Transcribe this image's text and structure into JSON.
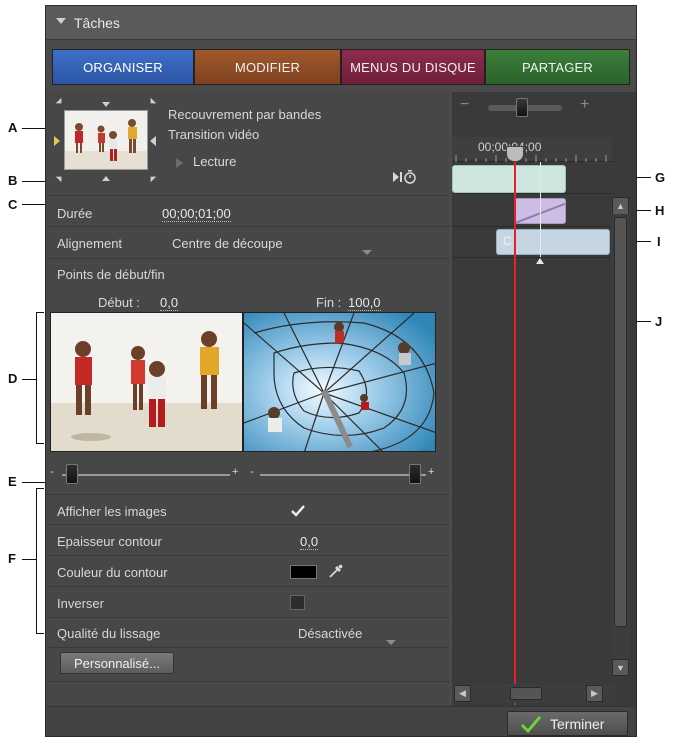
{
  "panel": {
    "title": "Tâches",
    "tabs": [
      {
        "label": "ORGANISER"
      },
      {
        "label": "MODIFIER"
      },
      {
        "label": "MENUS DU DISQUE"
      },
      {
        "label": "PARTAGER"
      }
    ]
  },
  "transition": {
    "name": "Recouvrement par bandes",
    "type": "Transition vidéo",
    "play_label": "Lecture"
  },
  "properties": {
    "duration_label": "Durée",
    "duration_value": "00;00;01;00",
    "alignment_label": "Alignement",
    "alignment_value": "Centre de découpe",
    "inout_label": "Points de début/fin",
    "start_label": "Début :",
    "start_value": "0,0",
    "end_label": "Fin :",
    "end_value": "100,0",
    "show_images_label": "Afficher les images",
    "show_images_checked": true,
    "border_width_label": "Epaisseur contour",
    "border_width_value": "0,0",
    "border_color_label": "Couleur du contour",
    "border_color": "#000000",
    "invert_label": "Inverser",
    "invert_checked": false,
    "smoothing_label": "Qualité du lissage",
    "smoothing_value": "Désactivée",
    "custom_button": "Personnalisé..."
  },
  "sliders": {
    "left_min": "-",
    "left_max": "+",
    "right_min": "-",
    "right_max": "+",
    "left_value_pct": 0,
    "right_value_pct": 100
  },
  "timeline": {
    "timecode": "00;00;04;00",
    "zoom_minus": "−",
    "zoom_plus": "+",
    "clip_i_label": "C"
  },
  "footer": {
    "done_label": "Terminer"
  },
  "callouts": [
    "A",
    "B",
    "C",
    "D",
    "E",
    "F",
    "G",
    "H",
    "I",
    "J"
  ],
  "colors": {
    "organiser": "#3a68bf",
    "modifier": "#94502a",
    "menus": "#842848",
    "partager": "#357435",
    "playhead": "#e0242a"
  }
}
